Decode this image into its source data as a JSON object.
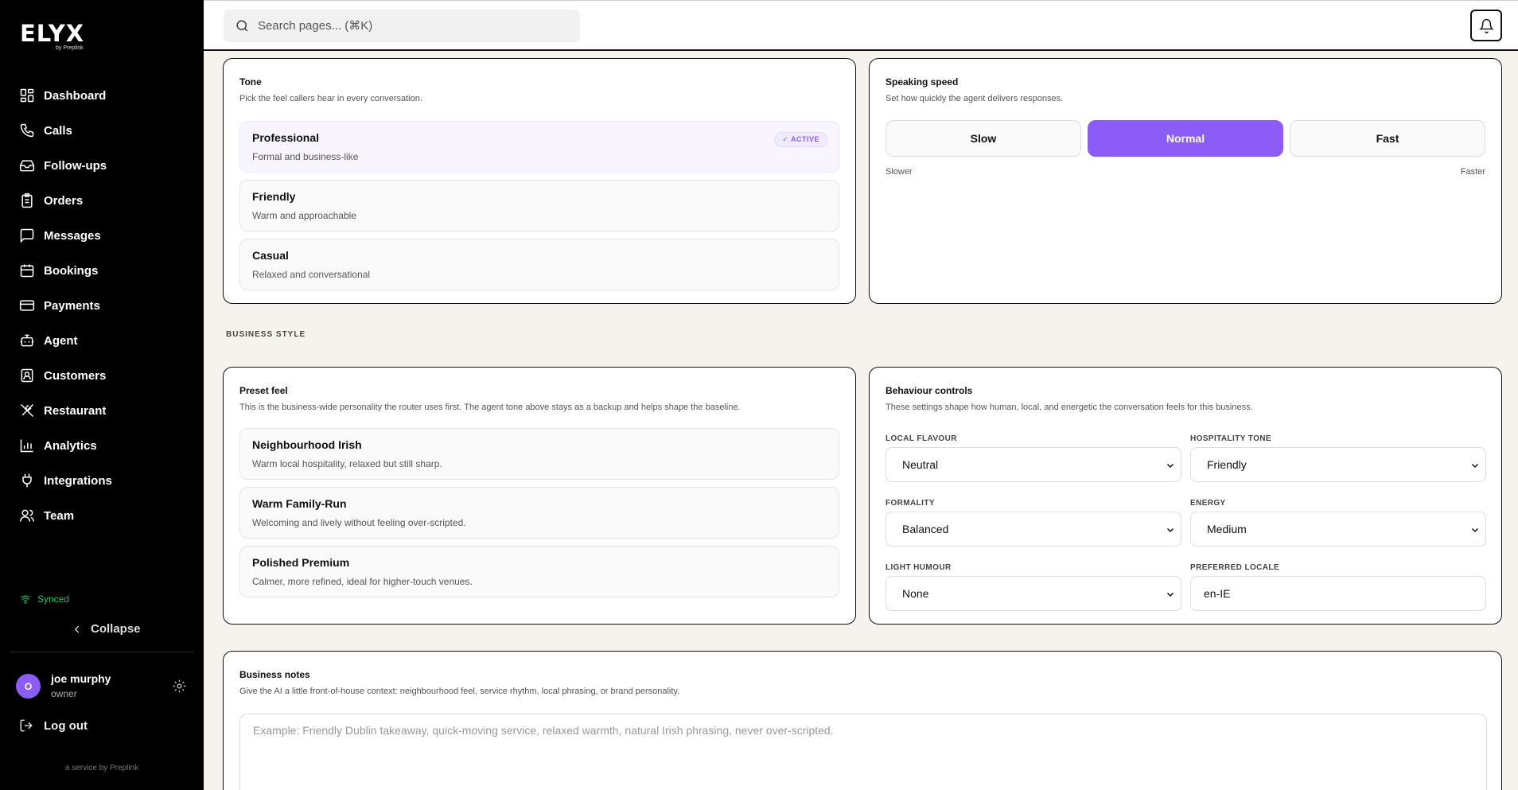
{
  "brand": {
    "logo": "ELYX",
    "logo_sub": "by Preplink"
  },
  "search": {
    "placeholder": "Search pages... (⌘K)"
  },
  "sidebar": {
    "items": [
      {
        "label": "Dashboard",
        "icon": "dashboard-icon"
      },
      {
        "label": "Calls",
        "icon": "phone-icon"
      },
      {
        "label": "Follow-ups",
        "icon": "inbox-icon"
      },
      {
        "label": "Orders",
        "icon": "clipboard-icon"
      },
      {
        "label": "Messages",
        "icon": "message-icon"
      },
      {
        "label": "Bookings",
        "icon": "calendar-icon"
      },
      {
        "label": "Payments",
        "icon": "card-icon"
      },
      {
        "label": "Agent",
        "icon": "bot-icon"
      },
      {
        "label": "Customers",
        "icon": "contact-icon"
      },
      {
        "label": "Restaurant",
        "icon": "utensils-icon"
      },
      {
        "label": "Analytics",
        "icon": "chart-icon"
      },
      {
        "label": "Integrations",
        "icon": "plug-icon"
      },
      {
        "label": "Team",
        "icon": "users-icon"
      }
    ],
    "synced": "Synced",
    "collapse": "Collapse",
    "user": {
      "initial": "O",
      "name": "joe murphy",
      "role": "owner"
    },
    "logout": "Log out",
    "service": "a service by Preplink"
  },
  "tone": {
    "title": "Tone",
    "subtitle": "Pick the feel callers hear in every conversation.",
    "active_badge": "✓ ACTIVE",
    "options": [
      {
        "title": "Professional",
        "desc": "Formal and business-like",
        "active": true
      },
      {
        "title": "Friendly",
        "desc": "Warm and approachable",
        "active": false
      },
      {
        "title": "Casual",
        "desc": "Relaxed and conversational",
        "active": false
      }
    ]
  },
  "speed": {
    "title": "Speaking speed",
    "subtitle": "Set how quickly the agent delivers responses.",
    "options": [
      "Slow",
      "Normal",
      "Fast"
    ],
    "selected": "Normal",
    "min_label": "Slower",
    "max_label": "Faster"
  },
  "business_style_label": "BUSINESS STYLE",
  "preset": {
    "title": "Preset feel",
    "subtitle": "This is the business-wide personality the router uses first. The agent tone above stays as a backup and helps shape the baseline.",
    "options": [
      {
        "title": "Neighbourhood Irish",
        "desc": "Warm local hospitality, relaxed but still sharp."
      },
      {
        "title": "Warm Family-Run",
        "desc": "Welcoming and lively without feeling over-scripted."
      },
      {
        "title": "Polished Premium",
        "desc": "Calmer, more refined, ideal for higher-touch venues."
      }
    ]
  },
  "behaviour": {
    "title": "Behaviour controls",
    "subtitle": "These settings shape how human, local, and energetic the conversation feels for this business.",
    "local_flavour": {
      "label": "LOCAL FLAVOUR",
      "value": "Neutral"
    },
    "hospitality_tone": {
      "label": "HOSPITALITY TONE",
      "value": "Friendly"
    },
    "formality": {
      "label": "FORMALITY",
      "value": "Balanced"
    },
    "energy": {
      "label": "ENERGY",
      "value": "Medium"
    },
    "light_humour": {
      "label": "LIGHT HUMOUR",
      "value": "None"
    },
    "preferred_locale": {
      "label": "PREFERRED LOCALE",
      "value": "en-IE"
    }
  },
  "notes": {
    "title": "Business notes",
    "subtitle": "Give the AI a little front-of-house context: neighbourhood feel, service rhythm, local phrasing, or brand personality.",
    "placeholder": "Example: Friendly Dublin takeaway, quick-moving service, relaxed warmth, natural Irish phrasing, never over-scripted."
  },
  "colors": {
    "accent": "#8b5cf6",
    "synced": "#22c55e",
    "sidebar_bg": "#000000",
    "page_bg": "#f6f2ee"
  }
}
